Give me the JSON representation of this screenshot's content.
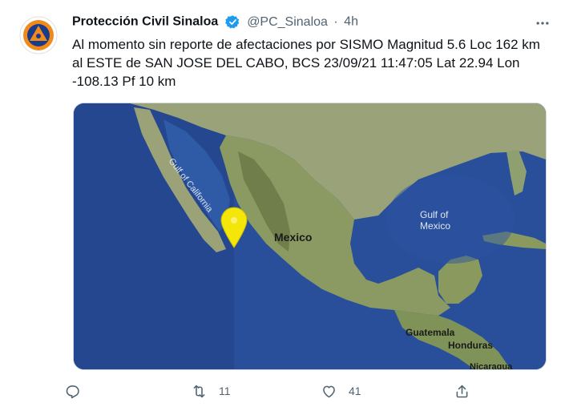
{
  "tweet": {
    "author_name": "Protección Civil Sinaloa",
    "handle": "@PC_Sinaloa",
    "separator": "·",
    "time": "4h",
    "text": "Al momento sin reporte de afectaciones por SISMO Magnitud 5.6 Loc  162 km al ESTE de SAN JOSE DEL CABO, BCS 23/09/21 11:47:05 Lat 22.94 Lon -108.13 Pf 10 km"
  },
  "map": {
    "labels": {
      "gulf_california": "Gulf of California",
      "mexico": "Mexico",
      "gulf_mexico_line1": "Gulf of",
      "gulf_mexico_line2": "Mexico",
      "guatemala": "Guatemala",
      "honduras": "Honduras",
      "nicaragua": "Nicaragua"
    },
    "pin_color": "#f5e60a"
  },
  "actions": {
    "reply_count": "",
    "retweet_count": "11",
    "like_count": "41",
    "share_count": ""
  },
  "colors": {
    "verified": "#1d9bf0",
    "muted": "#536471",
    "ocean": "#2a4f9a",
    "land": "#8a9a66"
  }
}
